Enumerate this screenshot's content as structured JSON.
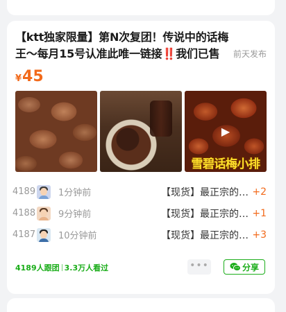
{
  "post": {
    "title_main": "【ktt独家限量】第N次复团！传说中的话梅王～每月15号认准此唯一链接",
    "title_emoji": "‼️",
    "title_tail": "我们已售",
    "published": "前天发布",
    "price_symbol": "¥",
    "price": "45",
    "video_caption": "雪碧话梅小排"
  },
  "orders": [
    {
      "no": "4189",
      "time": "1分钟前",
      "desc": "【现货】最正宗的话梅王",
      "qty": "+2"
    },
    {
      "no": "4188",
      "time": "9分钟前",
      "desc": "【现货】最正宗的话梅王",
      "qty": "+1"
    },
    {
      "no": "4187",
      "time": "10分钟前",
      "desc": "【现货】最正宗的话梅王",
      "qty": "+3"
    }
  ],
  "footer": {
    "followers": "4189人跟团",
    "views": "3.3万人看过",
    "more_label": "•••",
    "share_label": "分享"
  },
  "colors": {
    "accent_price": "#f26a1b",
    "accent_green": "#1aad19"
  }
}
